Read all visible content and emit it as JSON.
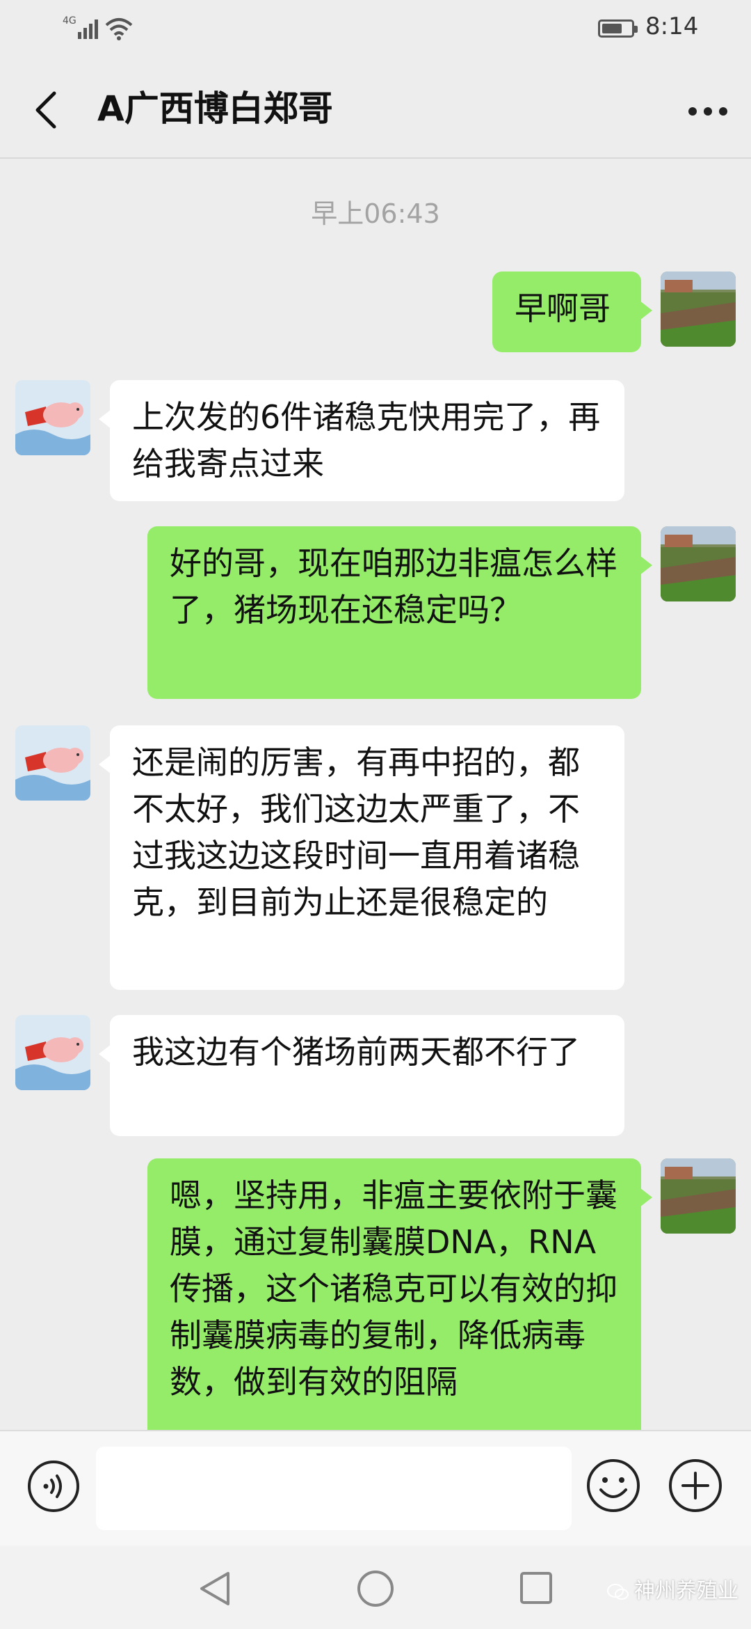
{
  "status_bar": {
    "network": "4G",
    "time": "8:14"
  },
  "header": {
    "title": "A广西博白郑哥",
    "back_icon": "chevron-left-icon",
    "more_icon": "more-dots-icon"
  },
  "chat": {
    "timestamp": "早上06:43",
    "messages": [
      {
        "side": "right",
        "text": "早啊哥"
      },
      {
        "side": "left",
        "text": "上次发的6件诸稳克快用完了，再给我寄点过来"
      },
      {
        "side": "right",
        "text": "好的哥，现在咱那边非瘟怎么样了，猪场现在还稳定吗？"
      },
      {
        "side": "left",
        "text": "还是闹的厉害，有再中招的，都不太好，我们这边太严重了，不过我这边这段时间一直用着诸稳克，到目前为止还是很稳定的"
      },
      {
        "side": "left",
        "text": "我这边有个猪场前两天都不行了"
      },
      {
        "side": "right",
        "text": "嗯，坚持用，非瘟主要依附于囊膜，通过复制囊膜DNA，RNA传播，这个诸稳克可以有效的抑制囊膜病毒的复制，降低病毒数，做到有效的阻隔"
      }
    ]
  },
  "input_bar": {
    "voice_icon": "voice-icon",
    "emoji_icon": "emoji-icon",
    "plus_icon": "plus-icon"
  },
  "nav_bar": {
    "back_icon": "nav-back-icon",
    "home_icon": "nav-home-icon",
    "recent_icon": "nav-recent-icon"
  },
  "watermark": "神州养殖业",
  "colors": {
    "background": "#ededed",
    "sent_bubble": "#95ec69",
    "received_bubble": "#ffffff"
  }
}
